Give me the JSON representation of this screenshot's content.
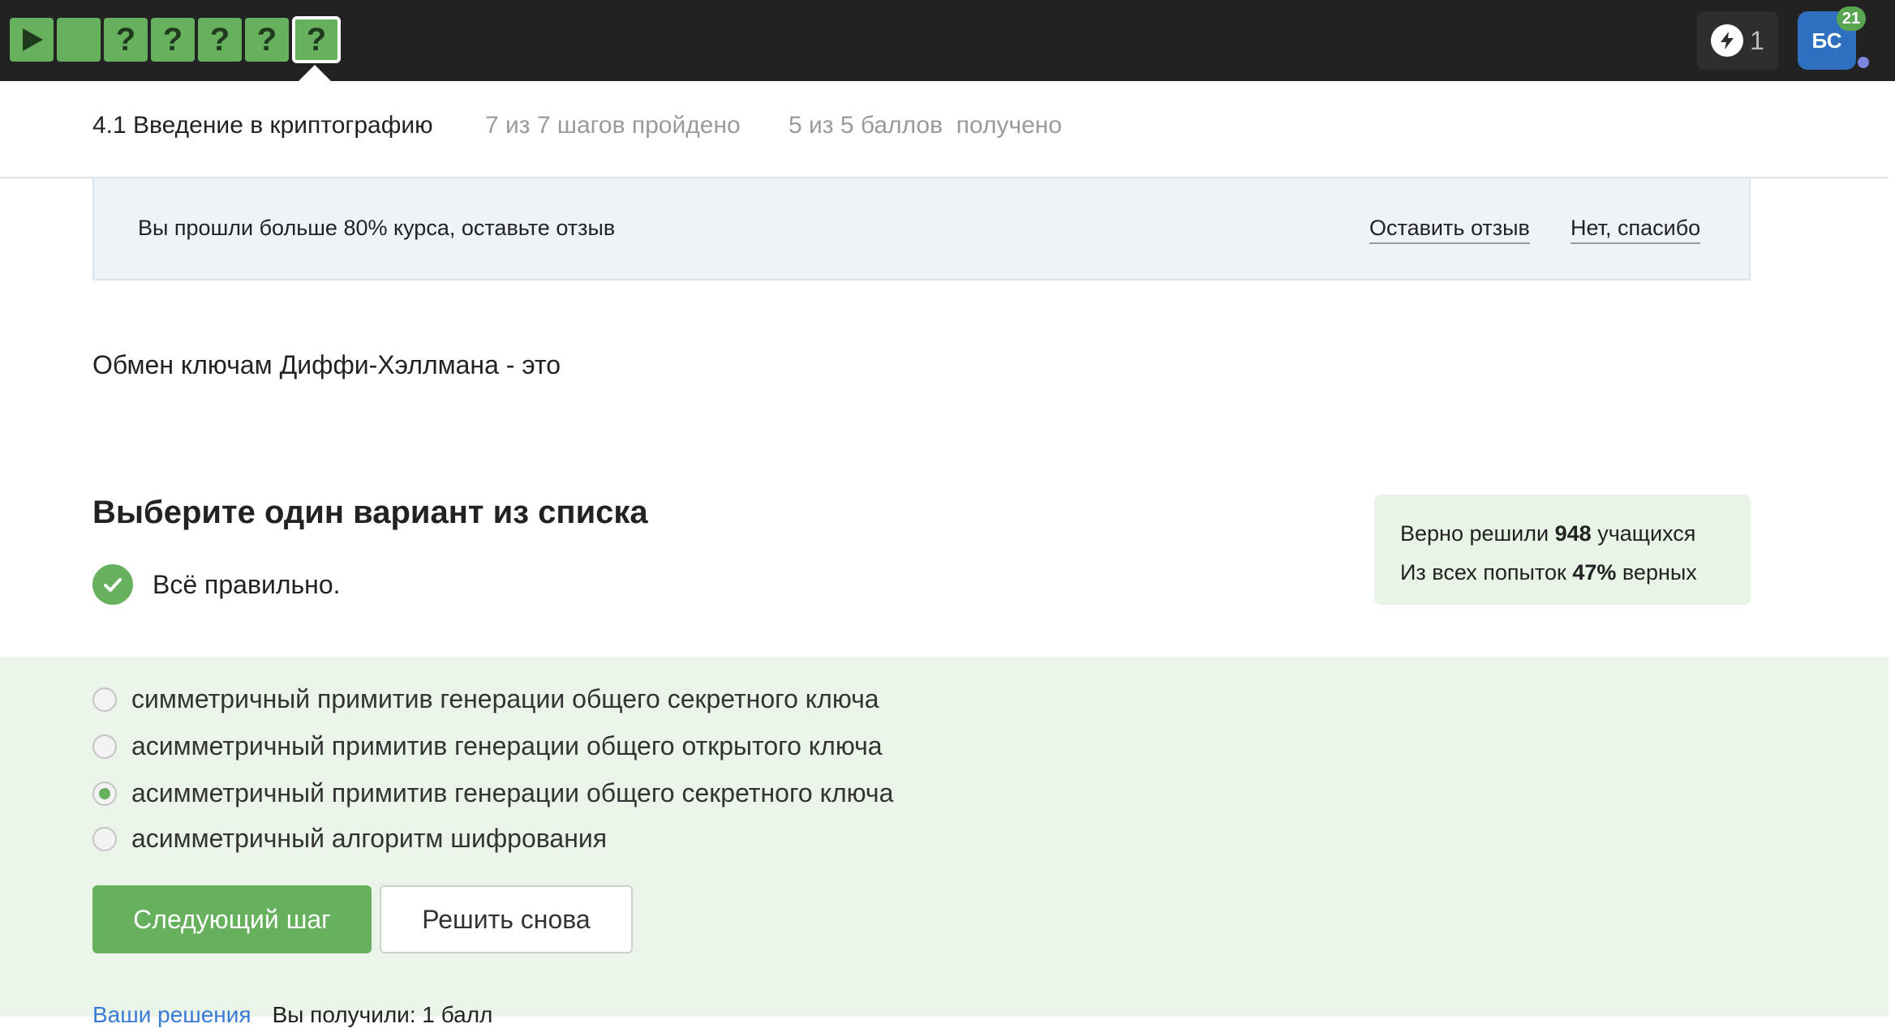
{
  "topbar": {
    "steps": [
      {
        "type": "video",
        "symbol": ""
      },
      {
        "type": "text",
        "symbol": ""
      },
      {
        "type": "quiz",
        "symbol": "?"
      },
      {
        "type": "quiz",
        "symbol": "?"
      },
      {
        "type": "quiz",
        "symbol": "?"
      },
      {
        "type": "quiz",
        "symbol": "?"
      },
      {
        "type": "quiz",
        "symbol": "?",
        "current": true
      }
    ],
    "energy_count": "1",
    "avatar_initials": "БС",
    "notifications_count": "21",
    "step_color": "#66b05e"
  },
  "lesson": {
    "title": "4.1 Введение в криптографию",
    "progress": "7 из 7 шагов пройдено",
    "points": "5 из 5 баллов  получено"
  },
  "banner": {
    "text": "Вы прошли больше 80% курса, оставьте отзыв",
    "review_link": "Оставить отзыв",
    "decline_link": "Нет, спасибо"
  },
  "question": {
    "text": "Обмен ключам Диффи-Хэллмана - это"
  },
  "quiz": {
    "instruction": "Выберите один вариант из списка",
    "result_text": "Всё правильно.",
    "stats": {
      "solved_prefix": "Верно решили",
      "solved_count": "948",
      "solved_suffix": "учащихся",
      "attempts_prefix": "Из всех попыток",
      "attempts_percent": "47%",
      "attempts_suffix": "верных"
    },
    "options": [
      {
        "label": "симметричный примитив генерации общего секретного ключа",
        "selected": false
      },
      {
        "label": "асимметричный примитив генерации общего открытого ключа",
        "selected": false
      },
      {
        "label": "асимметричный примитив генерации общего секретного ключа",
        "selected": true
      },
      {
        "label": "асимметричный алгоритм шифрования",
        "selected": false
      }
    ],
    "next_button": "Следующий шаг",
    "retry_button": "Решить снова",
    "solutions_link": "Ваши решения",
    "score_text": "Вы получили: 1 балл"
  }
}
